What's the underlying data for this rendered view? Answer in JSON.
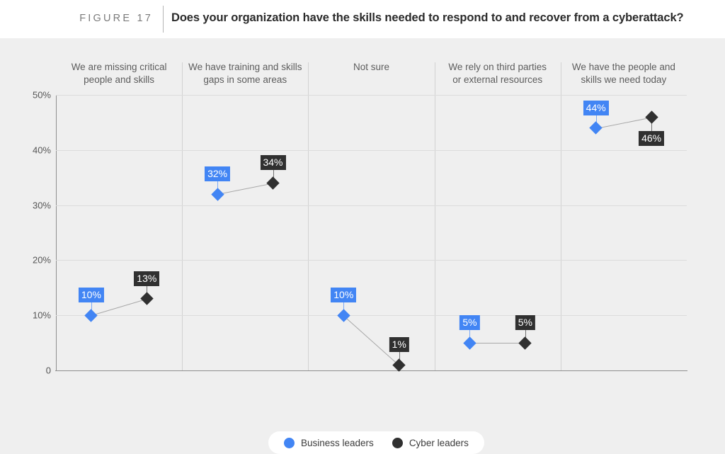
{
  "header": {
    "figure_label": "FIGURE 17",
    "title": "Does your organization have the skills needed to respond to and recover from a cyberattack?"
  },
  "legend": {
    "items": [
      {
        "label": "Business leaders",
        "color": "#4285f4",
        "marker": "circle-icon"
      },
      {
        "label": "Cyber leaders",
        "color": "#303030",
        "marker": "circle-icon"
      }
    ]
  },
  "axis": {
    "y_ticks": [
      "50%",
      "40%",
      "30%",
      "20%",
      "10%",
      "0"
    ]
  },
  "chart_data": {
    "type": "scatter",
    "title": "Does your organization have the skills needed to respond to and recover from a cyberattack?",
    "xlabel": "",
    "ylabel": "",
    "ylim": [
      0,
      50
    ],
    "ytick_values": [
      0,
      10,
      20,
      30,
      40,
      50
    ],
    "ytick_labels": [
      "0",
      "10%",
      "20%",
      "30%",
      "40%",
      "50%"
    ],
    "grid": true,
    "legend_position": "bottom-center",
    "categories": [
      "We are missing critical people and skills",
      "We have training and skills gaps in some areas",
      "Not sure",
      "We rely on third parties or external resources",
      "We have the people and skills we need today"
    ],
    "category_lines": [
      [
        "We are missing critical",
        "people and skills"
      ],
      [
        "We have training and skills",
        "gaps in some areas"
      ],
      [
        "Not sure"
      ],
      [
        "We rely on third parties",
        "or external resources"
      ],
      [
        "We have the people and",
        "skills we need today"
      ]
    ],
    "series": [
      {
        "name": "Business leaders",
        "color": "#4285f4",
        "values": [
          10,
          32,
          10,
          5,
          44
        ],
        "labels": [
          "10%",
          "32%",
          "10%",
          "5%",
          "44%"
        ],
        "label_positions": [
          "above",
          "above",
          "above",
          "above",
          "above"
        ]
      },
      {
        "name": "Cyber leaders",
        "color": "#303030",
        "values": [
          13,
          34,
          1,
          5,
          46
        ],
        "labels": [
          "13%",
          "34%",
          "1%",
          "5%",
          "46%"
        ],
        "label_positions": [
          "above",
          "above",
          "above",
          "above",
          "below"
        ]
      }
    ]
  }
}
